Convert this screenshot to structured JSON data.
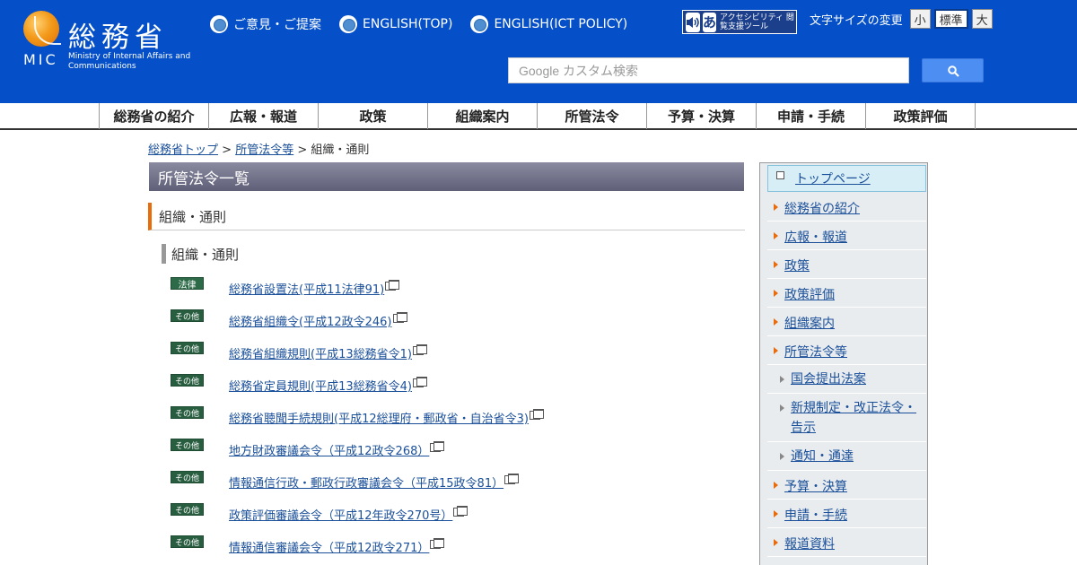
{
  "header": {
    "logo_kanji": "総務省",
    "logo_mic": "MIC",
    "logo_en": "Ministry of Internal Affairs and Communications",
    "top_links": [
      "ご意見・ご提案",
      "ENGLISH(TOP)",
      "ENGLISH(ICT POLICY)"
    ],
    "accessibility_tool": "アクセシビリティ 閲覧支援ツール",
    "accessibility_letter": "あ",
    "font_size_label": "文字サイズの変更",
    "font_sizes": [
      "小",
      "標準",
      "大"
    ],
    "search_placeholder": "Google カスタム検索",
    "colors": {
      "header_bg": "#0550c8",
      "accent": "#e86b0c"
    }
  },
  "global_nav": [
    "総務省の紹介",
    "広報・報道",
    "政策",
    "組織案内",
    "所管法令",
    "予算・決算",
    "申請・手続",
    "政策評価"
  ],
  "breadcrumb": {
    "home": "総務省トップ",
    "sep": ">",
    "parent": "所管法令等",
    "current": "組織・通則"
  },
  "main": {
    "title": "所管法令一覧",
    "section_heading": "組織・通則",
    "sub_heading": "組織・通則",
    "laws": [
      {
        "tag": "法律",
        "title": "総務省設置法(平成11法律91)"
      },
      {
        "tag": "その他",
        "title": "総務省組織令(平成12政令246)"
      },
      {
        "tag": "その他",
        "title": "総務省組織規則(平成13総務省令1)"
      },
      {
        "tag": "その他",
        "title": "総務省定員規則(平成13総務省令4)"
      },
      {
        "tag": "その他",
        "title": "総務省聴聞手続規則(平成12総理府・郵政省・自治省令3)"
      },
      {
        "tag": "その他",
        "title": "地方財政審議会令（平成12政令268）"
      },
      {
        "tag": "その他",
        "title": "情報通信行政・郵政行政審議会令（平成15政令81）"
      },
      {
        "tag": "その他",
        "title": "政策評価審議会令（平成12年政令270号）"
      },
      {
        "tag": "その他",
        "title": "情報通信審議会令（平成12政令271）"
      }
    ]
  },
  "side_nav": {
    "top": "トップページ",
    "items": [
      {
        "label": "総務省の紹介",
        "sub": false
      },
      {
        "label": "広報・報道",
        "sub": false
      },
      {
        "label": "政策",
        "sub": false
      },
      {
        "label": "政策評価",
        "sub": false
      },
      {
        "label": "組織案内",
        "sub": false
      },
      {
        "label": "所管法令等",
        "sub": false
      },
      {
        "label": "国会提出法案",
        "sub": true
      },
      {
        "label": "新規制定・改正法令・告示",
        "sub": true
      },
      {
        "label": "通知・通達",
        "sub": true
      },
      {
        "label": "予算・決算",
        "sub": false
      },
      {
        "label": "申請・手続",
        "sub": false
      },
      {
        "label": "報道資料",
        "sub": false
      }
    ]
  }
}
